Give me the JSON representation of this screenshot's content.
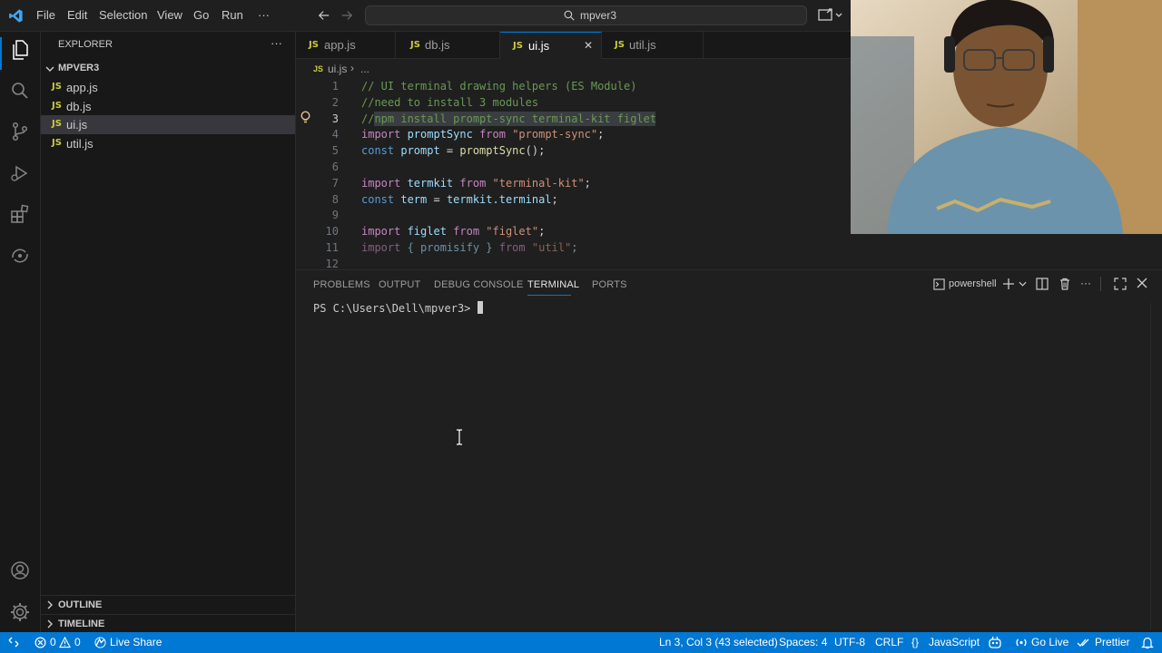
{
  "menu": [
    "File",
    "Edit",
    "Selection",
    "View",
    "Go",
    "Run",
    "···"
  ],
  "search": {
    "text": "mpver3"
  },
  "explorer": {
    "title": "EXPLORER",
    "more": "···",
    "folder": "MPVER3",
    "files": [
      {
        "icon": "JS",
        "name": "app.js"
      },
      {
        "icon": "JS",
        "name": "db.js"
      },
      {
        "icon": "JS",
        "name": "ui.js"
      },
      {
        "icon": "JS",
        "name": "util.js"
      }
    ],
    "outline": "OUTLINE",
    "timeline": "TIMELINE"
  },
  "tabs": [
    {
      "icon": "JS",
      "name": "app.js"
    },
    {
      "icon": "JS",
      "name": "db.js"
    },
    {
      "icon": "JS",
      "name": "ui.js",
      "close": "✕"
    },
    {
      "icon": "JS",
      "name": "util.js"
    }
  ],
  "breadcrumb": {
    "icon": "JS",
    "file": "ui.js",
    "sep": "›",
    "rest": "..."
  },
  "code": {
    "line_numbers": [
      "1",
      "2",
      "3",
      "4",
      "5",
      "6",
      "7",
      "8",
      "9",
      "10",
      "11",
      "12"
    ],
    "l1": "// UI terminal drawing helpers (ES Module)",
    "l2": "//need to install 3 modules",
    "l3": "//npm install prompt-sync terminal-kit figlet",
    "l4": {
      "a": "import",
      "b": " promptSync ",
      "c": "from",
      "d": " \"prompt-sync\"",
      "e": ";"
    },
    "l5": {
      "a": "const",
      "b": " prompt ",
      "c": "= ",
      "d": "promptSync",
      "e": "();"
    },
    "l7": {
      "a": "import",
      "b": " termkit ",
      "c": "from",
      "d": " \"terminal-kit\"",
      "e": ";"
    },
    "l8": {
      "a": "const",
      "b": " term ",
      "c": "= ",
      "d": "termkit.terminal",
      "e": ";"
    },
    "l10": {
      "a": "import",
      "b": " figlet ",
      "c": "from",
      "d": " \"figlet\"",
      "e": ";"
    },
    "l11": {
      "a": "import",
      "b": " { promisify } ",
      "c": "from",
      "d": " \"util\"",
      "e": ";"
    }
  },
  "panel": {
    "tabs": [
      "PROBLEMS",
      "OUTPUT",
      "DEBUG CONSOLE",
      "TERMINAL",
      "PORTS"
    ],
    "shell": "powershell",
    "prompt": "PS C:\\Users\\Dell\\mpver3> "
  },
  "status": {
    "errors": "0",
    "warnings": "0",
    "liveshare": "Live Share",
    "position": "Ln 3, Col 3 (43 selected)",
    "spaces": "Spaces: 4",
    "encoding": "UTF-8",
    "eol": "CRLF",
    "language": "JavaScript",
    "golive": "Go Live",
    "prettier": "Prettier"
  },
  "colors": {
    "statusbar": "#0078d4",
    "accent": "#0078d4",
    "js_icon": "#cbcb41"
  }
}
